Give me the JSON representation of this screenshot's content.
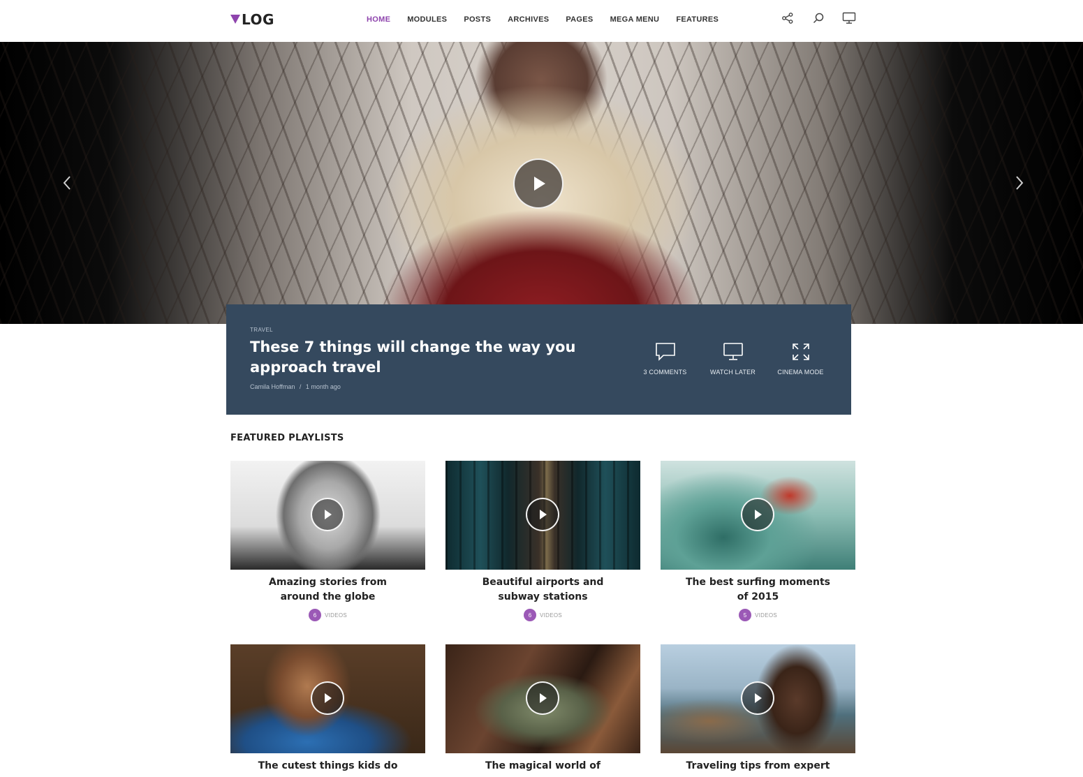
{
  "header": {
    "logo_text": "LOG",
    "nav": [
      {
        "label": "HOME",
        "active": true
      },
      {
        "label": "MODULES",
        "active": false
      },
      {
        "label": "POSTS",
        "active": false
      },
      {
        "label": "ARCHIVES",
        "active": false
      },
      {
        "label": "PAGES",
        "active": false
      },
      {
        "label": "MEGA MENU",
        "active": false
      },
      {
        "label": "FEATURES",
        "active": false
      }
    ],
    "icons": [
      "share-icon",
      "search-icon",
      "monitor-icon"
    ]
  },
  "hero": {
    "category": "TRAVEL",
    "title": "These 7 things will change the way you approach travel",
    "author": "Camila Hoffman",
    "date": "1 month ago",
    "actions": [
      {
        "icon": "comment-icon",
        "label": "3 COMMENTS"
      },
      {
        "icon": "monitor-icon",
        "label": "WATCH LATER"
      },
      {
        "icon": "expand-icon",
        "label": "CINEMA MODE"
      }
    ]
  },
  "playlists": {
    "title": "FEATURED PLAYLISTS",
    "videos_label": "VIDEOS",
    "items": [
      {
        "title": "Amazing stories from around the globe",
        "count": "6"
      },
      {
        "title": "Beautiful airports and subway stations",
        "count": "6"
      },
      {
        "title": "The best surfing moments of 2015",
        "count": "5"
      },
      {
        "title": "The cutest things kids do",
        "count": ""
      },
      {
        "title": "The magical world of",
        "count": ""
      },
      {
        "title": "Traveling tips from expert",
        "count": ""
      }
    ]
  },
  "colors": {
    "accent": "#8e44ad",
    "card_bg": "#35495e",
    "badge": "#9b59b6"
  }
}
